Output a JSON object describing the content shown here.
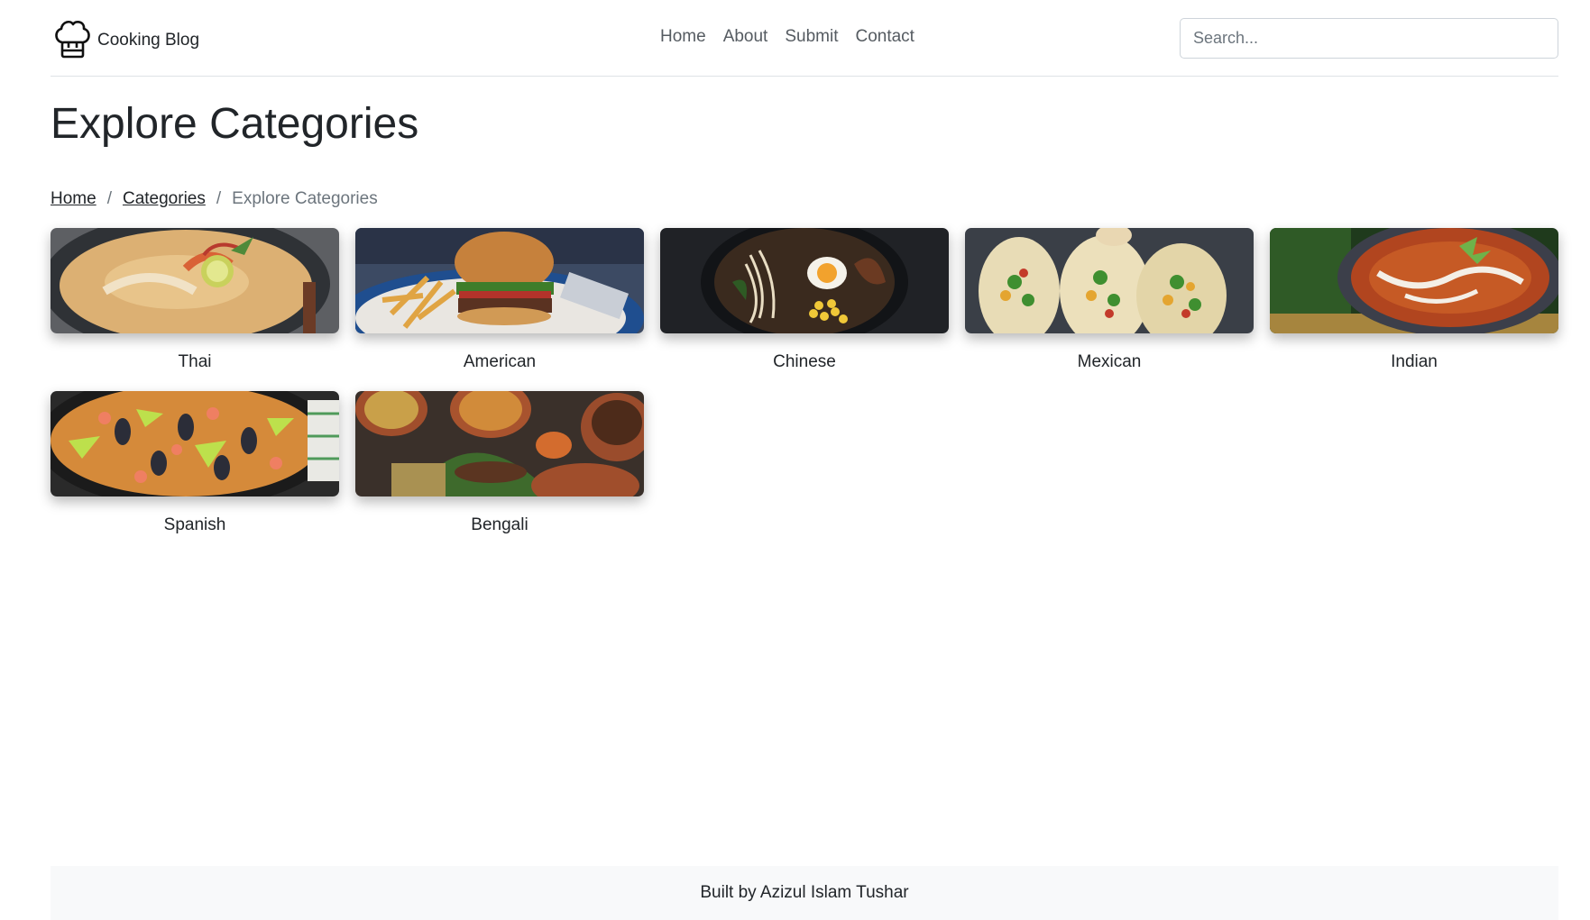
{
  "header": {
    "brand_name": "Cooking Blog",
    "brand_icon": "chef-hat-icon",
    "nav": [
      "Home",
      "About",
      "Submit",
      "Contact"
    ],
    "search_placeholder": "Search..."
  },
  "page_title": "Explore Categories",
  "breadcrumb": {
    "items": [
      "Home",
      "Categories"
    ],
    "separator": "/",
    "current": "Explore Categories"
  },
  "categories": [
    {
      "label": "Thai"
    },
    {
      "label": "American"
    },
    {
      "label": "Chinese"
    },
    {
      "label": "Mexican"
    },
    {
      "label": "Indian"
    },
    {
      "label": "Spanish"
    },
    {
      "label": "Bengali"
    }
  ],
  "footer": {
    "text": "Built by Azizul Islam Tushar"
  }
}
